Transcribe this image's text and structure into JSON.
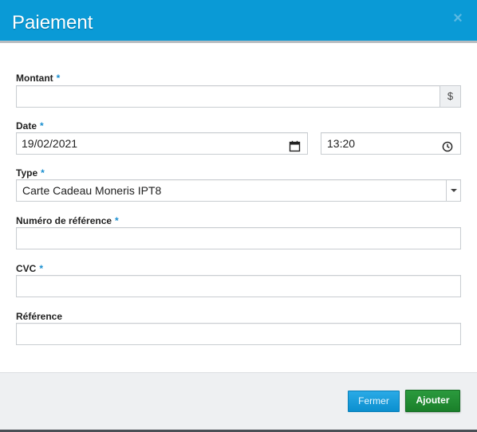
{
  "header": {
    "title": "Paiement",
    "close_glyph": "×"
  },
  "required_marker": "*",
  "fields": {
    "montant": {
      "label": "Montant",
      "required": true,
      "value": "",
      "addon": "$"
    },
    "date": {
      "label": "Date",
      "required": true,
      "date_value": "19/02/2021",
      "time_value": "13:20"
    },
    "type": {
      "label": "Type",
      "required": true,
      "selected": "Carte Cadeau Moneris IPT8"
    },
    "numero_reference": {
      "label": "Numéro de référence",
      "required": true,
      "value": ""
    },
    "cvc": {
      "label": "CVC",
      "required": true,
      "value": ""
    },
    "reference": {
      "label": "Référence",
      "required": false,
      "value": ""
    }
  },
  "footer": {
    "close_label": "Fermer",
    "add_label": "Ajouter"
  },
  "colors": {
    "header_bg": "#0a9ad6",
    "required_marker": "#1a8fd0",
    "close_button": "#1a9edd",
    "add_button": "#228c33",
    "footer_bg": "#eef0f2"
  },
  "icons": {
    "close": "close-icon",
    "date": "calendar-icon",
    "time": "clock-icon",
    "select": "chevron-down-icon"
  }
}
